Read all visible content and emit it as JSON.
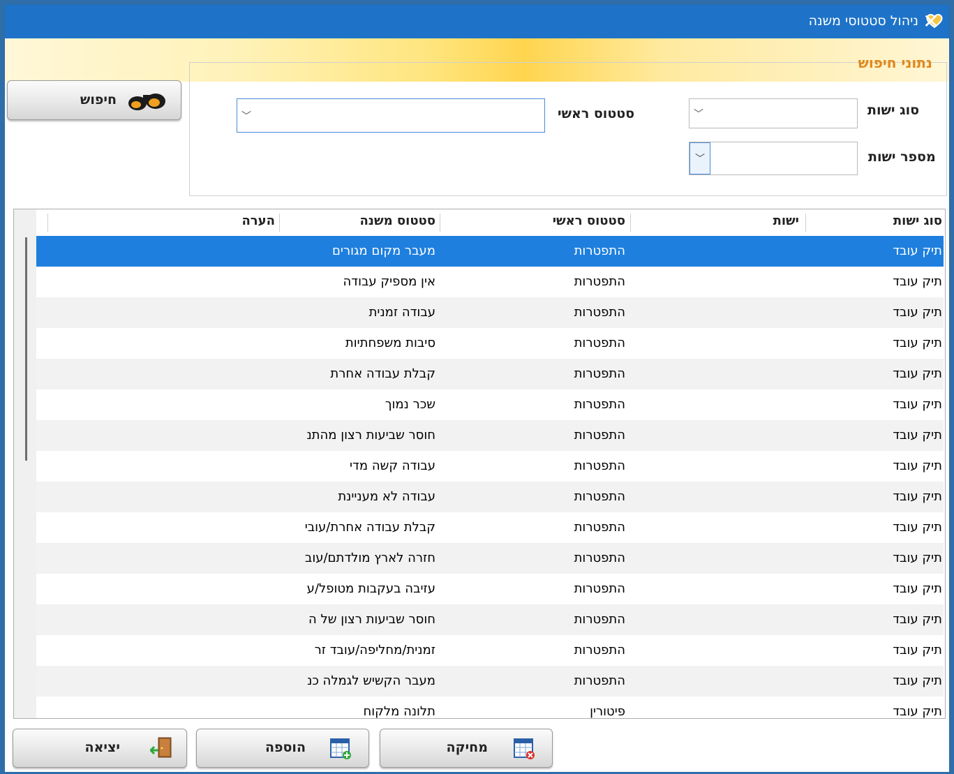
{
  "window": {
    "title": "ניהול סטטוסי משנה",
    "close_icon": "close-icon"
  },
  "search": {
    "legend": "נתוני חיפוש",
    "entity_type_label": "סוג ישות",
    "entity_number_label": "מספר ישות",
    "main_status_label": "סטטוס ראשי",
    "entity_type_value": "",
    "entity_number_value": "",
    "main_status_value": "",
    "search_button": "חיפוש"
  },
  "grid": {
    "columns": [
      "סוג ישות",
      "ישות",
      "סטטוס ראשי",
      "סטטוס משנה",
      "הערה"
    ],
    "rows": [
      {
        "type": "תיק עובד",
        "entity": "",
        "main": "התפטרות",
        "sub": "מעבר מקום מגורים",
        "note": ""
      },
      {
        "type": "תיק עובד",
        "entity": "",
        "main": "התפטרות",
        "sub": "אין מספיק עבודה",
        "note": ""
      },
      {
        "type": "תיק עובד",
        "entity": "",
        "main": "התפטרות",
        "sub": "עבודה זמנית",
        "note": ""
      },
      {
        "type": "תיק עובד",
        "entity": "",
        "main": "התפטרות",
        "sub": "סיבות משפחתיות",
        "note": ""
      },
      {
        "type": "תיק עובד",
        "entity": "",
        "main": "התפטרות",
        "sub": "קבלת עבודה אחרת",
        "note": ""
      },
      {
        "type": "תיק עובד",
        "entity": "",
        "main": "התפטרות",
        "sub": "שכר נמוך",
        "note": ""
      },
      {
        "type": "תיק עובד",
        "entity": "",
        "main": "התפטרות",
        "sub": "חוסר שביעות רצון מהתנ",
        "note": ""
      },
      {
        "type": "תיק עובד",
        "entity": "",
        "main": "התפטרות",
        "sub": "עבודה קשה מדי",
        "note": ""
      },
      {
        "type": "תיק עובד",
        "entity": "",
        "main": "התפטרות",
        "sub": "עבודה לא מעניינת",
        "note": ""
      },
      {
        "type": "תיק עובד",
        "entity": "",
        "main": "התפטרות",
        "sub": "קבלת עבודה אחרת/עובי",
        "note": ""
      },
      {
        "type": "תיק עובד",
        "entity": "",
        "main": "התפטרות",
        "sub": "חזרה לארץ מולדתם/עוב",
        "note": ""
      },
      {
        "type": "תיק עובד",
        "entity": "",
        "main": "התפטרות",
        "sub": "עזיבה בעקבות מטופל/ע",
        "note": ""
      },
      {
        "type": "תיק עובד",
        "entity": "",
        "main": "התפטרות",
        "sub": "חוסר שביעות רצון של ה",
        "note": ""
      },
      {
        "type": "תיק עובד",
        "entity": "",
        "main": "התפטרות",
        "sub": "זמנית/מחליפה/עובד זר",
        "note": ""
      },
      {
        "type": "תיק עובד",
        "entity": "",
        "main": "התפטרות",
        "sub": "מעבר הקשיש לגמלה כנ",
        "note": ""
      },
      {
        "type": "תיק עובד",
        "entity": "",
        "main": "פיטורין",
        "sub": "תלונה מלקוח",
        "note": ""
      }
    ]
  },
  "footer": {
    "delete_button": "מחיקה",
    "add_button": "הוספה",
    "exit_button": "יציאה"
  },
  "colors": {
    "titlebar": "#1e73c8",
    "selection": "#1e7fde",
    "legend": "#e0881a"
  }
}
